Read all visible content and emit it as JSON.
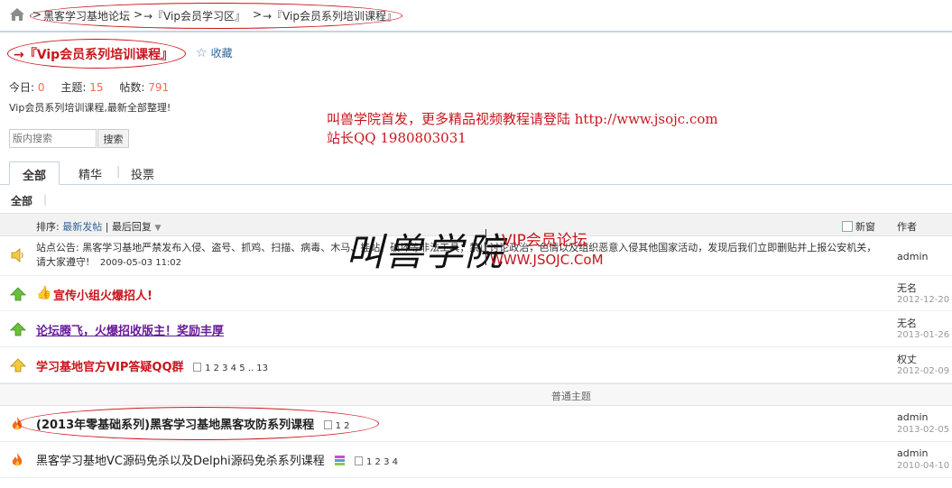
{
  "breadcrumb": {
    "items": [
      "黑客学习基地论坛",
      "→『Vip会员学习区』",
      "→『Vip会员系列培训课程』"
    ],
    "separator": ">"
  },
  "forum": {
    "title": "→『Vip会员系列培训课程』",
    "favorite_label": "收藏",
    "stats": {
      "today_label": "今日:",
      "today": "0",
      "topics_label": "主题:",
      "topics": "15",
      "posts_label": "帖数:",
      "posts": "791"
    },
    "description": "Vip会员系列培训课程,最新全部整理!"
  },
  "promo": {
    "line1": "叫兽学院首发，更多精品视频教程请登陆 http://www.jsojc.com",
    "line2": "站长QQ 1980803031"
  },
  "search": {
    "placeholder": "版内搜索",
    "button_label": "搜索"
  },
  "tabs": [
    {
      "label": "全部",
      "active": true
    },
    {
      "label": "精华",
      "active": false
    },
    {
      "label": "投票",
      "active": false
    }
  ],
  "subnav": {
    "label": "全部"
  },
  "list_header": {
    "sort_label": "排序:",
    "sort_newest": "最新发帖",
    "sort_sep": "|",
    "sort_last": "最后回复",
    "new_window": "新窗",
    "author_col": "作者"
  },
  "announcement": {
    "text": "站点公告: 黑客学习基地严禁发布入侵、盗号、抓鸡、扫描、病毒、木马、挂站、破坏等非法工具；禁止讨论政治，色情以及组织恶意入侵其他国家活动，发现后我们立即删贴并上报公安机关，请大家遵守!",
    "date": "2009-05-03 11:02",
    "author": "admin"
  },
  "sticky_topics": [
    {
      "title": "宣传小组火爆招人!",
      "color": "#c8161d",
      "author": "无名",
      "date": "2012-12-20",
      "pages": ""
    },
    {
      "title": "论坛腾飞，火爆招收版主！奖励丰厚",
      "color": "#6a1b9a",
      "author": "无名",
      "date": "2013-01-26",
      "pages": ""
    },
    {
      "title": "学习基地官方VIP答疑QQ群",
      "color": "#c8161d",
      "author": "权丈",
      "date": "2012-02-09",
      "pages": "1 2 3 4 5 .. 13"
    }
  ],
  "normal_divider": "普通主题",
  "normal_topics": [
    {
      "title": "(2013年零基础系列)黑客学习基地黑客攻防系列课程",
      "author": "admin",
      "date": "2013-02-05",
      "pages": "1 2"
    },
    {
      "title": "黑客学习基地VC源码免杀以及Delphi源码免杀系列课程",
      "author": "admin",
      "date": "2010-04-10",
      "pages": "1 2 3 4"
    }
  ],
  "watermark": {
    "name": "叫兽学院",
    "subtitle": "VIP会员论坛",
    "url": "WWW.JSOJC.CoM"
  },
  "colors": {
    "accent_red": "#c8161d",
    "link_blue": "#336699",
    "stat_orange": "#f26c4f",
    "border_blue": "#c2d5e3"
  },
  "icons": {
    "home": "home-icon",
    "favorite": "star-icon",
    "announcement": "speaker-icon",
    "sticky": "green-up-arrow-icon",
    "sticky_global": "yellow-up-arrow-icon",
    "hot": "flame-icon",
    "thumb": "thumb-up-icon",
    "attachment": "rar-attachment-icon"
  }
}
